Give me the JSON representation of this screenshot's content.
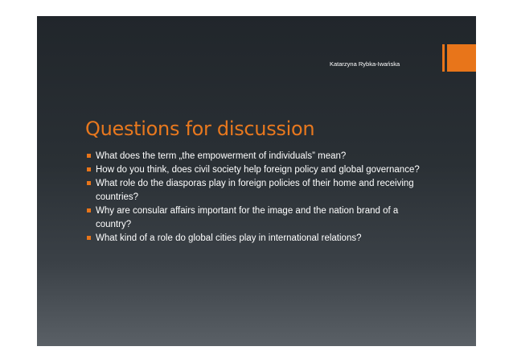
{
  "slide": {
    "author": "Katarzyna Rybka-Iwańska",
    "title": "Questions for discussion",
    "bullets": [
      "What does the term „the empowerment of individuals” mean?",
      "How do you think, does civil society help foreign policy and global governance?",
      "What role do the diasporas play in foreign policies of their home and receiving countries?",
      "Why are consular affairs important for the image and the nation brand of a country?",
      "What kind of a role do global cities play in international relations?"
    ],
    "accent_color": "#e8751a",
    "background_color": "#272c31"
  }
}
